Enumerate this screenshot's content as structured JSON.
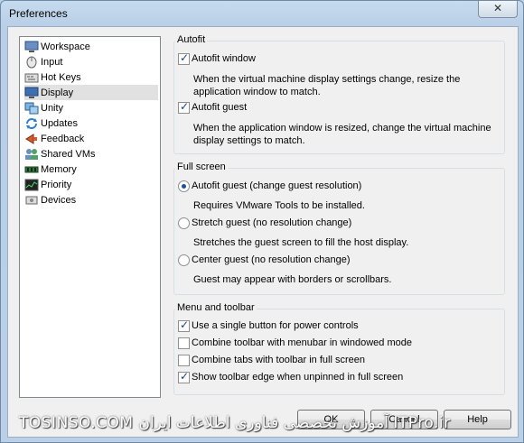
{
  "window": {
    "title": "Preferences",
    "close_glyph": "✕"
  },
  "sidebar": {
    "items": [
      {
        "label": "Workspace",
        "icon": "workspace-icon"
      },
      {
        "label": "Input",
        "icon": "input-icon"
      },
      {
        "label": "Hot Keys",
        "icon": "hotkeys-icon"
      },
      {
        "label": "Display",
        "icon": "display-icon",
        "selected": true
      },
      {
        "label": "Unity",
        "icon": "unity-icon"
      },
      {
        "label": "Updates",
        "icon": "updates-icon"
      },
      {
        "label": "Feedback",
        "icon": "feedback-icon"
      },
      {
        "label": "Shared VMs",
        "icon": "shared-vms-icon"
      },
      {
        "label": "Memory",
        "icon": "memory-icon"
      },
      {
        "label": "Priority",
        "icon": "priority-icon"
      },
      {
        "label": "Devices",
        "icon": "devices-icon"
      }
    ]
  },
  "autofit": {
    "title": "Autofit",
    "window_label": "Autofit window",
    "window_checked": true,
    "window_desc": "When the virtual machine display settings change, resize the application window to match.",
    "guest_label": "Autofit guest",
    "guest_checked": true,
    "guest_desc": "When the application window is resized, change the virtual machine display settings to match."
  },
  "fullscreen": {
    "title": "Full screen",
    "autofit_label": "Autofit guest (change guest resolution)",
    "autofit_desc": "Requires VMware Tools to be installed.",
    "stretch_label": "Stretch guest (no resolution change)",
    "stretch_desc": "Stretches the guest screen to fill the host display.",
    "center_label": "Center guest (no resolution change)",
    "center_desc": "Guest may appear with borders or scrollbars.",
    "selected": "autofit"
  },
  "menu_toolbar": {
    "title": "Menu and toolbar",
    "single_button_label": "Use a single button for power controls",
    "single_button_checked": true,
    "combine_menubar_label": "Combine toolbar with menubar in windowed mode",
    "combine_menubar_checked": false,
    "combine_tabs_label": "Combine tabs with toolbar in full screen",
    "combine_tabs_checked": false,
    "show_edge_label": "Show toolbar edge when unpinned in full screen",
    "show_edge_checked": true
  },
  "buttons": {
    "ok": "OK",
    "cancel": "Cancel",
    "help": "Help"
  },
  "watermark": "TOSINSO.COM   آموزش تخصصی فناوری اطلاعات ایران   ITPro.ir"
}
